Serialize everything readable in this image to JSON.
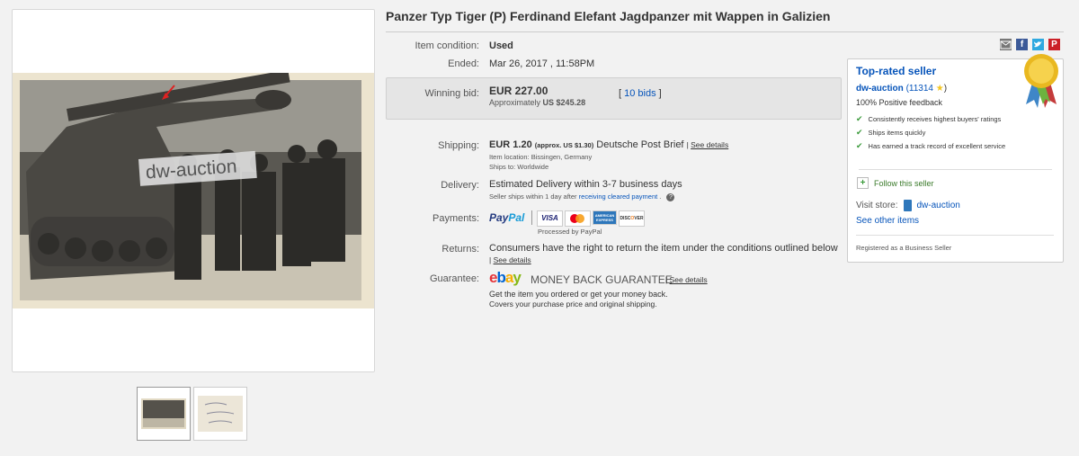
{
  "listing": {
    "title": "Panzer Typ Tiger (P) Ferdinand Elefant Jagdpanzer mit Wappen in Galizien",
    "watermark": "dw-auction"
  },
  "details": {
    "condition_label": "Item condition:",
    "condition_value": "Used",
    "ended_label": "Ended:",
    "ended_value": "Mar 26, 2017 , 11:58PM",
    "winning_label": "Winning bid:",
    "winning_value": "EUR 227.00",
    "approx_prefix": "Approximately",
    "approx_value": "US $245.28",
    "bids_link": "10 bids",
    "shipping_label": "Shipping:",
    "shipping_price": "EUR 1.20",
    "shipping_approx": "(approx. US $1.30)",
    "shipping_method": "Deutsche Post Brief",
    "see_details": "See details",
    "item_location": "Item location:  Bissingen, Germany",
    "ships_to": "Ships to:  Worldwide",
    "delivery_label": "Delivery:",
    "delivery_value": "Estimated Delivery within 3-7 business days",
    "delivery_note": "Seller ships within 1 day after",
    "delivery_link": "receiving cleared payment",
    "payments_label": "Payments:",
    "paypal": "PayPal",
    "processed": "Processed by PayPal",
    "cards": [
      "VISA",
      "MasterCard",
      "AMERICAN EXPRESS",
      "DISCOVER"
    ],
    "returns_label": "Returns:",
    "returns_value": "Consumers have the right to return the item under the conditions outlined below",
    "guarantee_label": "Guarantee:",
    "mbg": "MONEY BACK GUARANTEE",
    "guarantee_line1": "Get the item you ordered or get your money back.",
    "guarantee_line2": "Covers your purchase price and original shipping."
  },
  "seller": {
    "badge": "Top-rated seller",
    "name": "dw-auction",
    "score": "(11314",
    "score_close": ")",
    "feedback": "100% Positive feedback",
    "bullets": [
      "Consistently receives highest buyers' ratings",
      "Ships items quickly",
      "Has earned a track record of excellent service"
    ],
    "follow": "Follow this seller",
    "visit_label": "Visit store:",
    "store": "dw-auction",
    "other": "See other items",
    "registered": "Registered as a Business Seller"
  },
  "colors": {
    "link": "#0654ba",
    "ebay_e": "#e53238",
    "ebay_b": "#0064d2",
    "ebay_a": "#f5af02",
    "ebay_y": "#86b817"
  },
  "icons": [
    "email-icon",
    "facebook-icon",
    "twitter-icon",
    "pinterest-icon",
    "ribbon-icon",
    "star-icon",
    "check-icon",
    "plus-icon",
    "store-icon",
    "help-icon"
  ]
}
